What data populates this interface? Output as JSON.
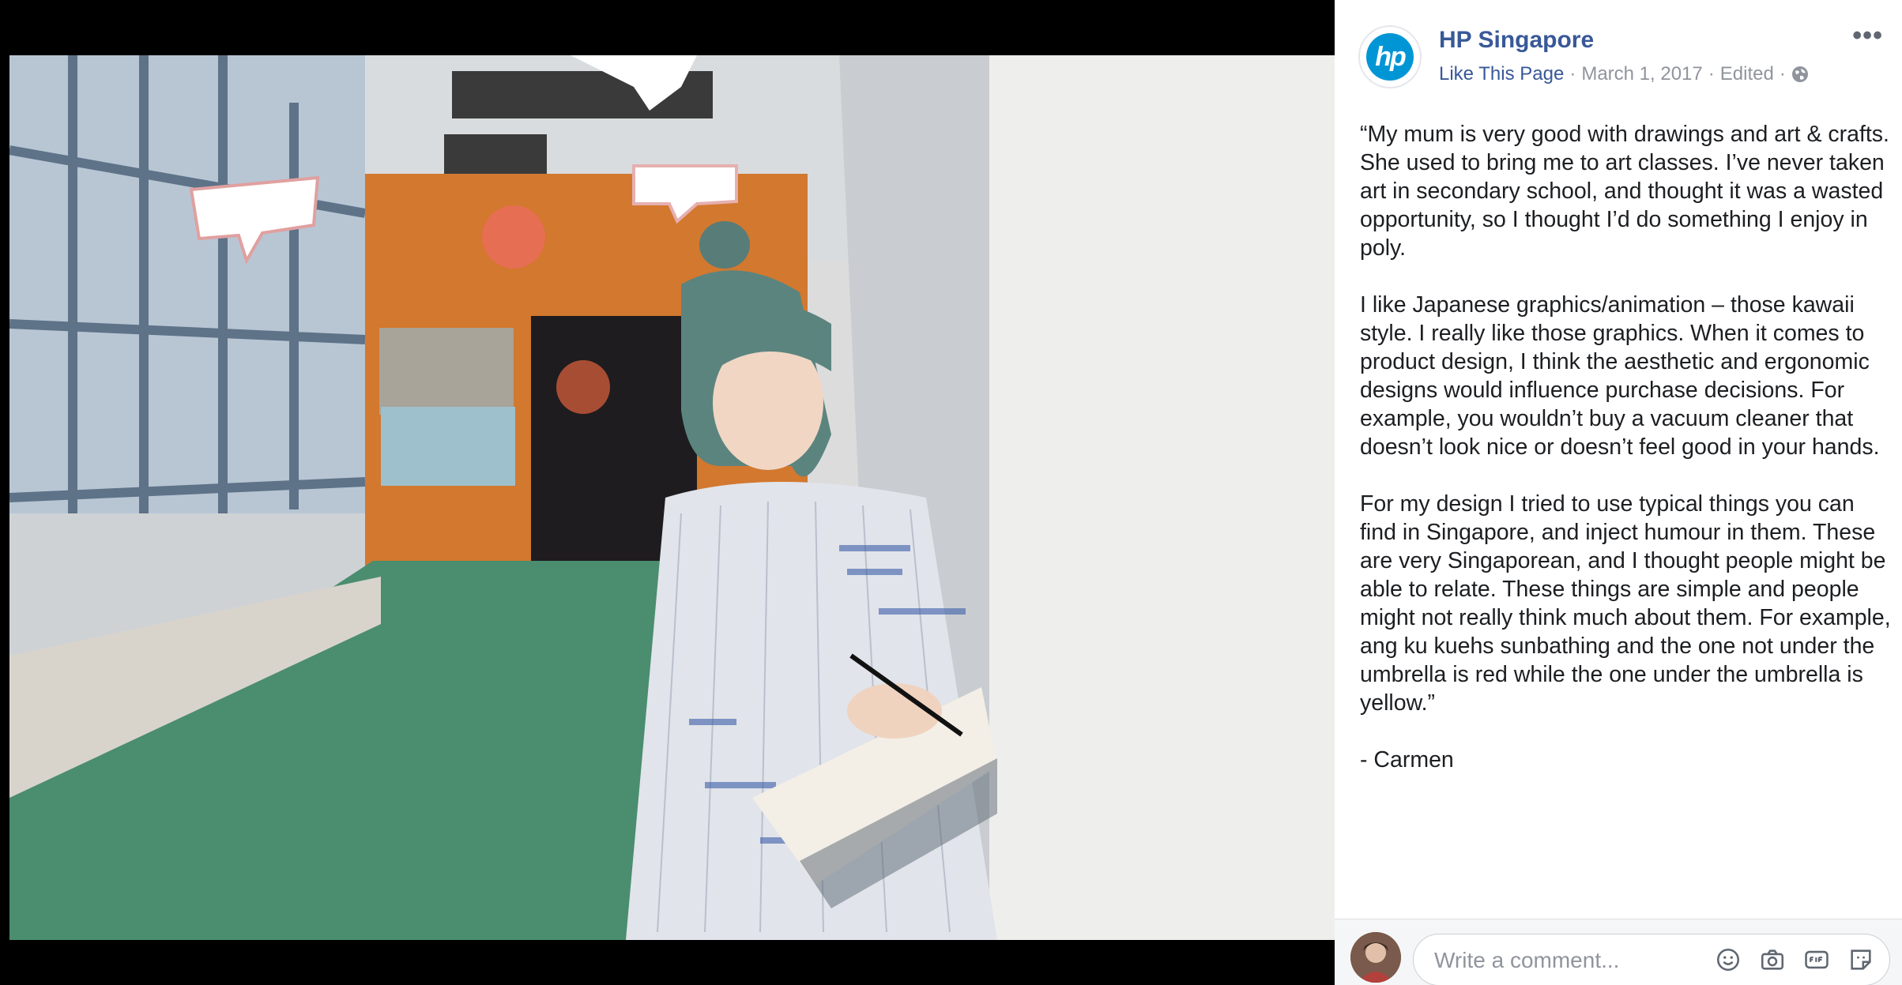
{
  "post": {
    "page_name": "HP Singapore",
    "avatar_text": "hp",
    "like_label": "Like This Page",
    "separator": "·",
    "date": "March 1, 2017",
    "edited": "Edited",
    "more_label": "•••",
    "paragraphs": [
      "“My mum is very good with drawings and art & crafts. She used to bring me to art classes. I’ve never taken art in secondary school, and thought it was a wasted opportunity, so I thought I’d do something I enjoy in poly.",
      "I like Japanese graphics/animation – those kawaii style. I really like those graphics. When it comes to product design, I think the aesthetic and ergonomic designs would influence purchase decisions. For example, you wouldn’t buy a vacuum cleaner that doesn’t look nice or doesn’t feel good in your hands.",
      "For my design I tried to use typical things you can find in Singapore, and inject humour in them. These are very Singaporean, and I thought people might be able to relate. These things are simple and people might not really think much about them. For example, ang ku kuehs sunbathing and the one not under the umbrella is red while the one under the umbrella is yellow.”",
      "- Carmen"
    ]
  },
  "comment": {
    "placeholder": "Write a comment...",
    "icons": [
      "emoji-icon",
      "camera-icon",
      "gif-icon",
      "sticker-icon"
    ]
  },
  "colors": {
    "link": "#385898",
    "meta": "#90949c",
    "brand": "#0096d6"
  }
}
